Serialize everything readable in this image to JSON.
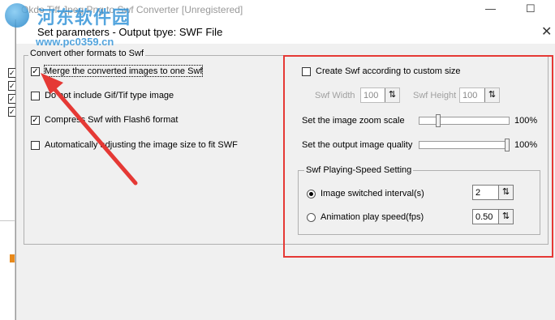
{
  "main_window": {
    "title": "Okdo Tiff Jpeg Png to Swf Converter [Unregistered]",
    "minimize_label": "—",
    "maximize_label": "☐"
  },
  "watermark": {
    "brand": "河东软件园",
    "url": "www.pc0359.cn"
  },
  "dialog": {
    "title": "Set parameters - Output tpye: SWF File",
    "close_label": "✕",
    "left_group": {
      "label": "Convert other formats to Swf",
      "options": [
        {
          "label": "Merge the converted images to one Swf",
          "checked": true
        },
        {
          "label": "Do not include Gif/Tif type image",
          "checked": false
        },
        {
          "label": "Compress Swf with Flash6 format",
          "checked": true
        },
        {
          "label": "Automatically adjusting the image size to fit SWF",
          "checked": false
        }
      ]
    },
    "right_panel": {
      "custom_size": {
        "label": "Create Swf according to custom size",
        "checked": false
      },
      "width": {
        "label": "Swf Width",
        "value": "100"
      },
      "height": {
        "label": "Swf Height",
        "value": "100"
      },
      "zoom": {
        "label": "Set the image zoom scale",
        "value_text": "100%",
        "level": 0.2
      },
      "quality": {
        "label": "Set the output image quality",
        "value_text": "100%",
        "level": 1.0
      },
      "speed_group": {
        "label": "Swf Playing-Speed Setting",
        "interval": {
          "label": "Image switched interval(s)",
          "value": "2",
          "selected": true
        },
        "fps": {
          "label": "Animation play speed(fps)",
          "value": "0.50",
          "selected": false
        }
      }
    }
  },
  "annotation_colors": {
    "red_box": "#e53935",
    "arrow": "#e53935"
  }
}
